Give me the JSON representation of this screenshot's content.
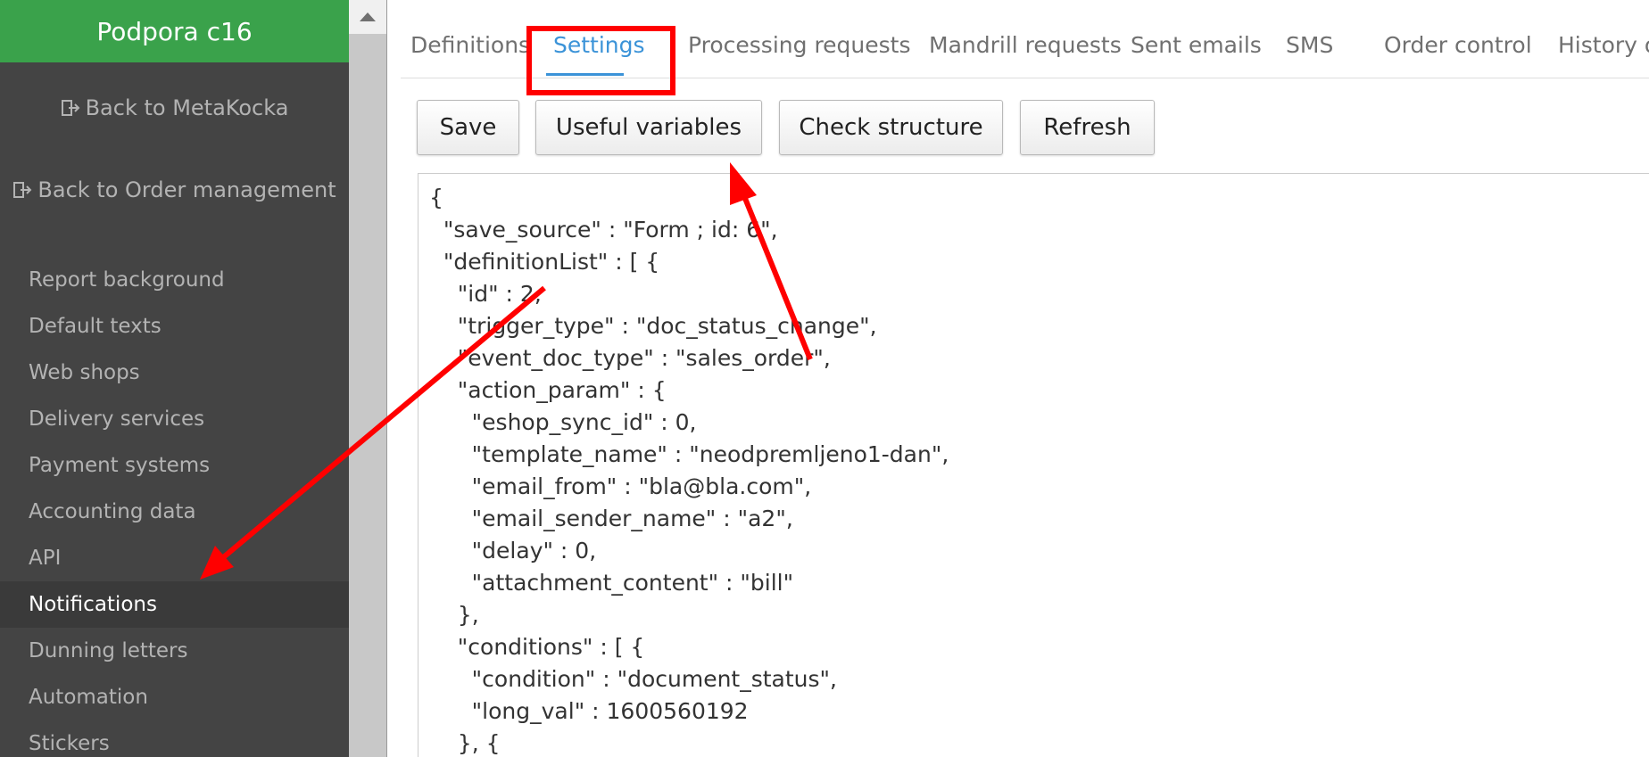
{
  "sidebar": {
    "title": "Podpora c16",
    "back_links": [
      {
        "label": "Back to MetaKocka",
        "icon": "logout-icon"
      },
      {
        "label": "Back to Order management",
        "icon": "logout-icon"
      }
    ],
    "items": [
      {
        "label": "Report background"
      },
      {
        "label": "Default texts"
      },
      {
        "label": "Web shops"
      },
      {
        "label": "Delivery services"
      },
      {
        "label": "Payment systems"
      },
      {
        "label": "Accounting data"
      },
      {
        "label": "API"
      },
      {
        "label": "Notifications",
        "active": true
      },
      {
        "label": "Dunning letters"
      },
      {
        "label": "Automation"
      },
      {
        "label": "Stickers"
      }
    ]
  },
  "tabs": [
    {
      "label": "Definitions"
    },
    {
      "label": "Settings",
      "active": true
    },
    {
      "label": "Processing requests"
    },
    {
      "label": "Mandrill requests"
    },
    {
      "label": "Sent emails"
    },
    {
      "label": "SMS"
    },
    {
      "label": "Order control"
    },
    {
      "label": "History of"
    }
  ],
  "toolbar": {
    "save_label": "Save",
    "useful_variables_label": "Useful variables",
    "check_structure_label": "Check structure",
    "refresh_label": "Refresh"
  },
  "editor": {
    "lines": [
      "{",
      "  \"save_source\" : \"Form ; id: 6\",",
      "  \"definitionList\" : [ {",
      "    \"id\" : 2,",
      "    \"trigger_type\" : \"doc_status_change\",",
      "    \"event_doc_type\" : \"sales_order\",",
      "    \"action_param\" : {",
      "      \"eshop_sync_id\" : 0,",
      "      \"template_name\" : \"neodpremljeno1-dan\",",
      "      \"email_from\" : \"bla@bla.com\",",
      "      \"email_sender_name\" : \"a2\",",
      "      \"delay\" : 0,",
      "      \"attachment_content\" : \"bill\"",
      "    },",
      "    \"conditions\" : [ {",
      "      \"condition\" : \"document_status\",",
      "      \"long_val\" : 1600560192",
      "    }, {"
    ]
  },
  "colors": {
    "sidebar_bg": "#444444",
    "header_green": "#3aa24b",
    "active_tab": "#3b93d8",
    "annotation_red": "#ff0000"
  }
}
